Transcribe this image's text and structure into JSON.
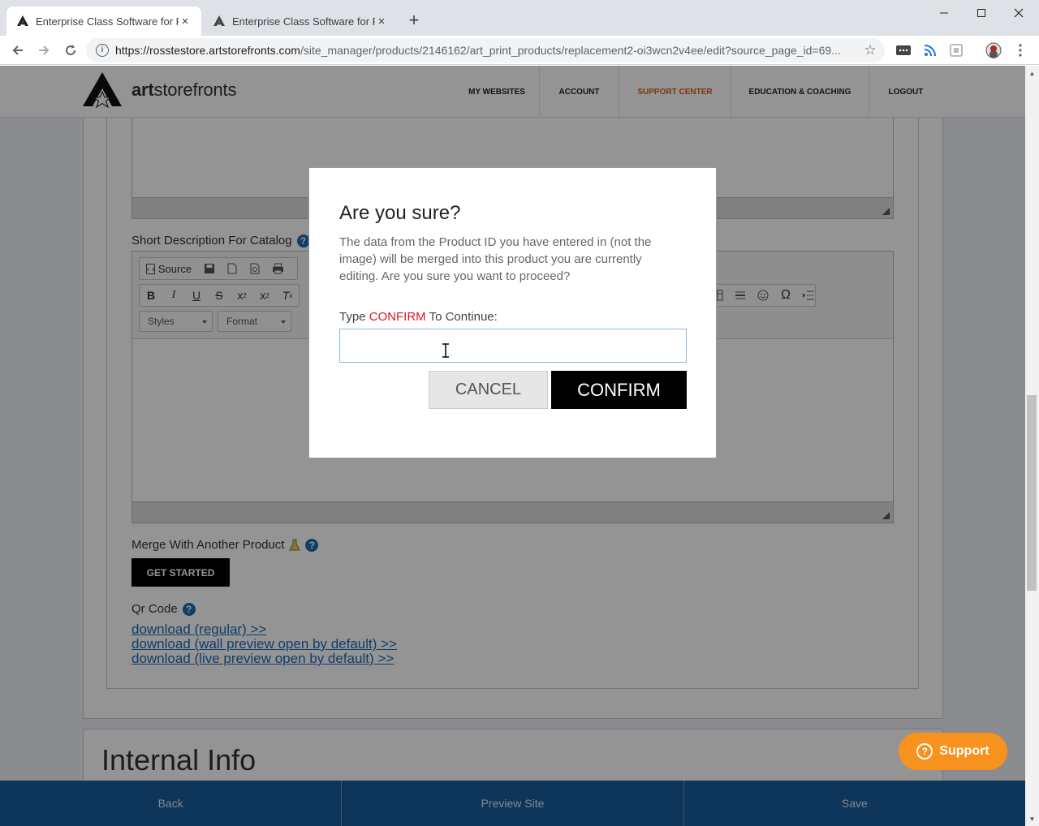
{
  "browser": {
    "tabs": [
      {
        "title": "Enterprise Class Software for Print",
        "close": "×"
      },
      {
        "title": "Enterprise Class Software for Print",
        "close": "×"
      }
    ],
    "new_tab": "+",
    "url_host": "https://rosstestore.artstorefronts.com",
    "url_path": "/site_manager/products/2146162/art_print_products/replacement2-oi3wcn2v4ee/edit?source_page_id=69..."
  },
  "header": {
    "logo_bold": "art",
    "logo_rest": "storefronts",
    "nav": [
      "MY WEBSITES",
      "ACCOUNT",
      "SUPPORT CENTER",
      "EDUCATION & COACHING",
      "LOGOUT"
    ]
  },
  "form": {
    "short_description_label": "Short Description For Catalog",
    "editor": {
      "source_label": "Source",
      "styles_label": "Styles",
      "format_label": "Format"
    },
    "merge_label": "Merge With Another Product",
    "get_started": "GET STARTED",
    "qr_label": "Qr Code",
    "qr_links": [
      "download (regular) >>",
      "download (wall preview open by default) >>",
      "download (live preview open by default) >>"
    ]
  },
  "internal_info_title": "Internal Info",
  "support_label": "Support",
  "bottom_bar": [
    "Back",
    "Preview Site",
    "Save"
  ],
  "modal": {
    "title": "Are you sure?",
    "body": "The data from the Product ID you have entered in (not the image) will be merged into this product you are currently editing. Are you sure you want to proceed?",
    "label_prefix": "Type ",
    "label_keyword": "CONFIRM",
    "label_suffix": " To Continue:",
    "input_value": "",
    "input_placeholder": "",
    "cancel_label": "CANCEL",
    "confirm_label": "CONFIRM"
  },
  "colors": {
    "accent_orange": "#e05a1a",
    "keyword_red": "#d9171f",
    "bottom_bar_blue": "#185d9c",
    "support_orange": "#f7921e"
  }
}
